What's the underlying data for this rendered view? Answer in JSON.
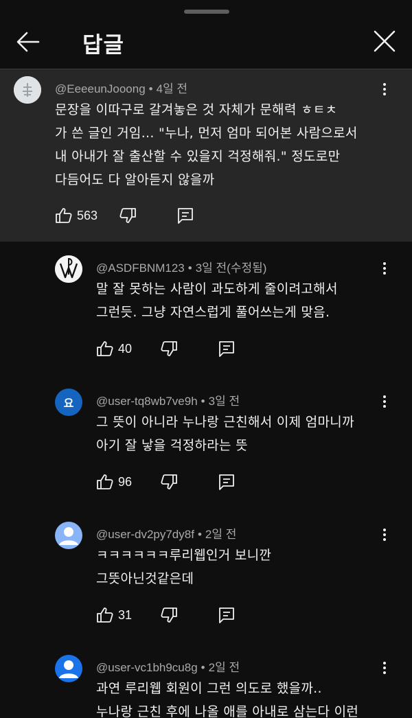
{
  "header": {
    "title": "답글"
  },
  "colors": {
    "background": "#0f0f0f",
    "parent_background": "#272727",
    "meta": "#aaaaaa",
    "avatar_blue": "#1a73e8",
    "avatar_lightblue": "#8ab4f8"
  },
  "parent_comment": {
    "author": "@EeeeunJooong",
    "time": "4일 전",
    "lines": [
      "문장을 이따구로 갈겨놓은 것 자체가 문해력 ㅎㅌㅊ",
      "가 쓴 글인 거임... \"누나, 먼저 엄마 되어본 사람으로서",
      "내 아내가 잘 출산할 수 있을지 걱정해줘.\" 정도로만",
      "다듬어도 다 알아듣지 않을까"
    ],
    "likes": "563",
    "avatar_icon": "user-avatar-icon"
  },
  "replies": [
    {
      "author": "@ASDFBNM123",
      "time": "3일 전(수정됨)",
      "lines": [
        "말 잘 못하는 사람이 과도하게 줄이려고해서",
        "그런듯. 그냥 자연스럽게 풀어쓰는게 맞음."
      ],
      "likes": "40",
      "avatar_type": "logo"
    },
    {
      "author": "@user-tq8wb7ve9h",
      "time": "3일 전",
      "lines": [
        "그 뜻이 아니라 누나랑 근친해서 이제 엄마니까",
        "아기 잘 낳을 걱정하라는 뜻"
      ],
      "likes": "96",
      "avatar_type": "letter",
      "avatar_letter": "요"
    },
    {
      "author": "@user-dv2py7dy8f",
      "time": "2일 전",
      "lines": [
        "ㅋㅋㅋㅋㅋㅋ루리웹인거 보니깐",
        "그뜻아닌것같은데"
      ],
      "likes": "31",
      "avatar_type": "default-lightblue"
    },
    {
      "author": "@user-vc1bh9cu8g",
      "time": "2일 전",
      "lines": [
        "과연 루리웹 회원이 그런 의도로 했을까..",
        "누나랑 근친 후에 나올 애를 아내로 삼는다 이런"
      ],
      "likes": "",
      "avatar_type": "default-blue"
    }
  ]
}
